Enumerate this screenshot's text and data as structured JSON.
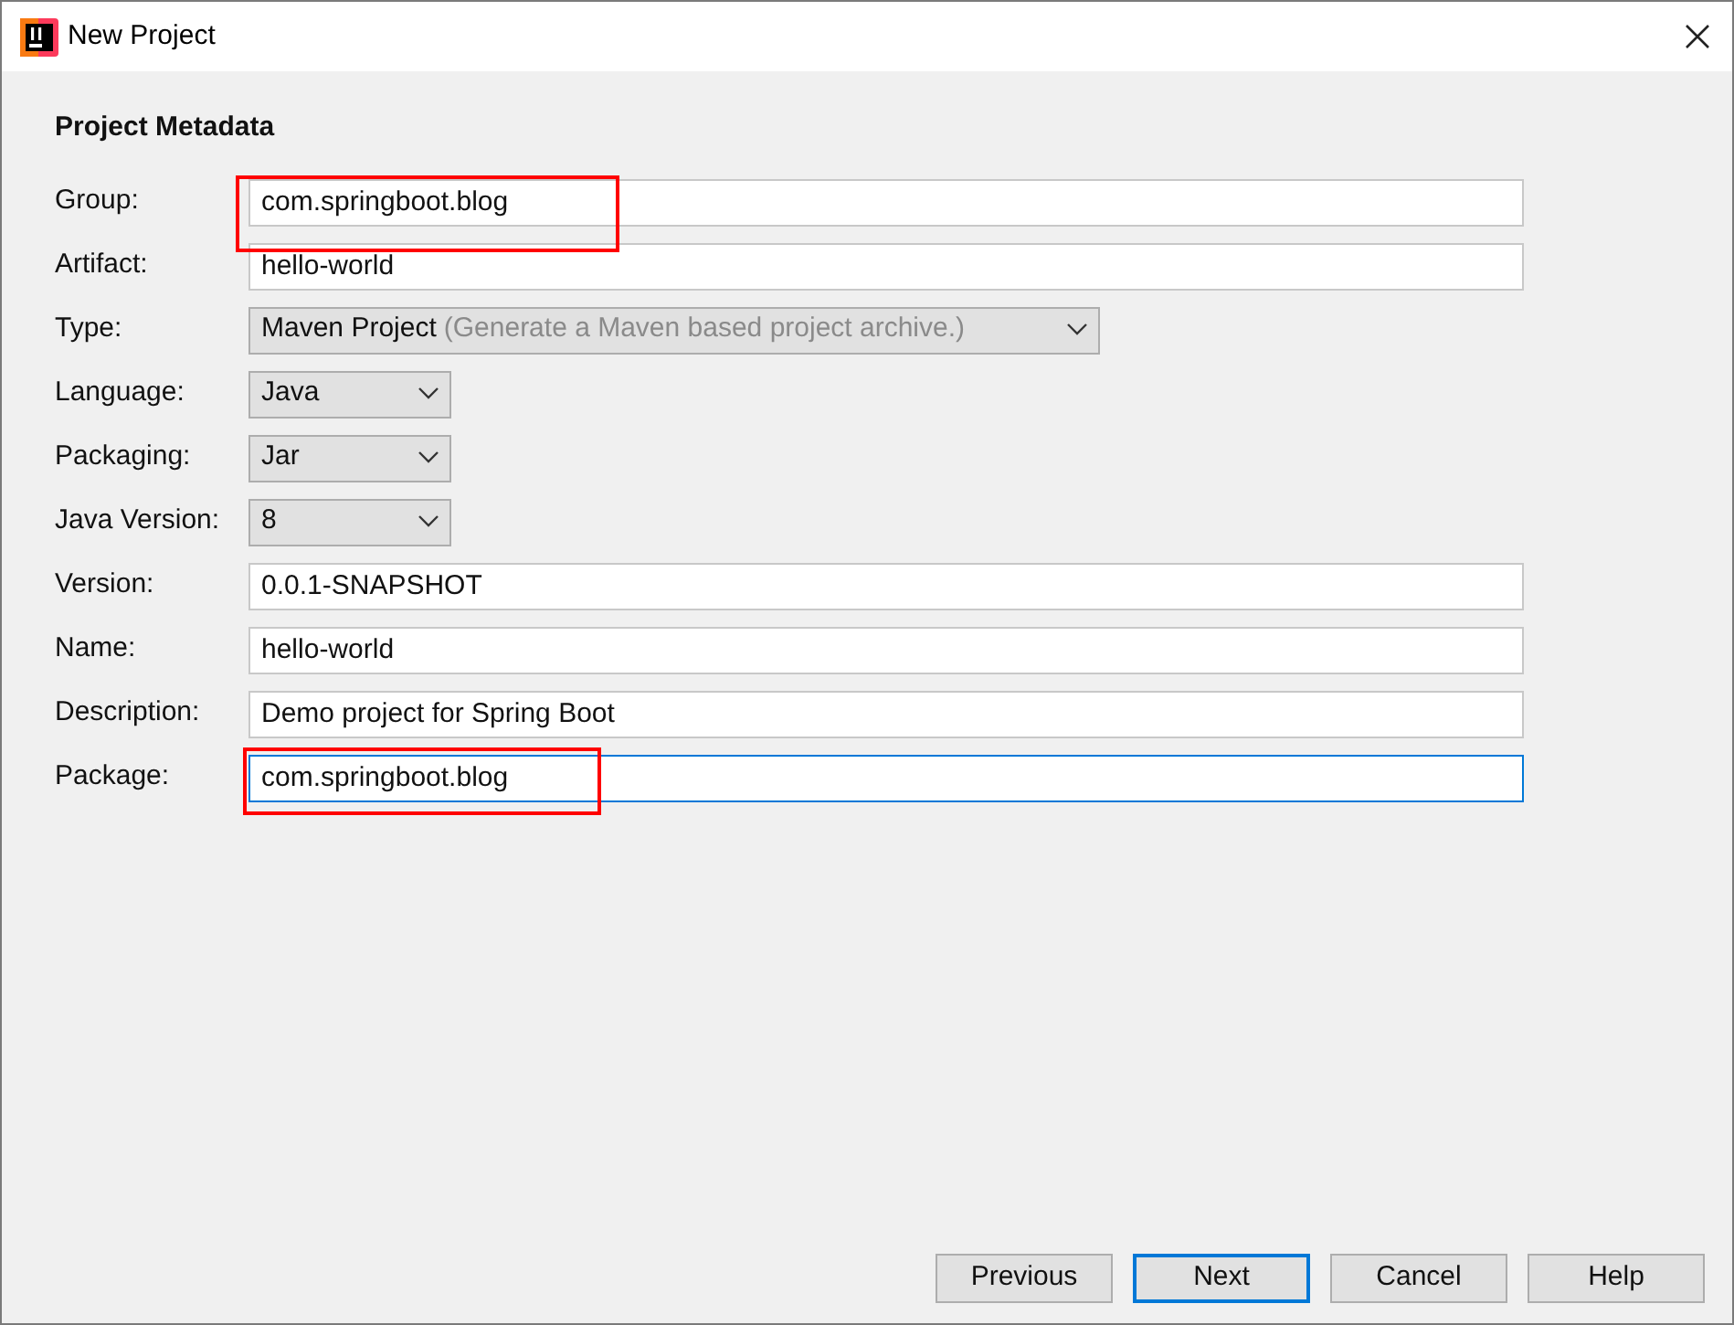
{
  "window": {
    "title": "New Project"
  },
  "heading": "Project Metadata",
  "groups": [
    [
      {
        "label": "Group:",
        "kind": "text",
        "value": "com.springboot.blog",
        "focused": false,
        "highlighted": true,
        "highlight_spans_next": true
      },
      {
        "label": "Artifact:",
        "kind": "text",
        "value": "hello-world",
        "focused": false
      }
    ],
    [
      {
        "label": "Type:",
        "kind": "wide-combo",
        "value": "Maven Project",
        "detail": "(Generate a Maven based project archive.)"
      },
      {
        "label": "Language:",
        "kind": "combo",
        "value": "Java"
      }
    ],
    [
      {
        "label": "Packaging:",
        "kind": "combo",
        "value": "Jar"
      },
      {
        "label": "Java Version:",
        "kind": "combo",
        "value": "8"
      }
    ],
    [
      {
        "label": "Version:",
        "kind": "text",
        "value": "0.0.1-SNAPSHOT",
        "focused": false
      },
      {
        "label": "Name:",
        "kind": "text",
        "value": "hello-world",
        "focused": false
      },
      {
        "label": "Description:",
        "kind": "text",
        "value": "Demo project for Spring Boot",
        "focused": false
      },
      {
        "label": "Package:",
        "kind": "text",
        "value": "com.springboot.blog",
        "focused": true,
        "highlighted": true,
        "highlight_spans_next": false
      }
    ]
  ],
  "buttons": [
    {
      "label": "Previous",
      "default": false
    },
    {
      "label": "Next",
      "default": true
    },
    {
      "label": "Cancel",
      "default": false
    },
    {
      "label": "Help",
      "default": false
    }
  ]
}
